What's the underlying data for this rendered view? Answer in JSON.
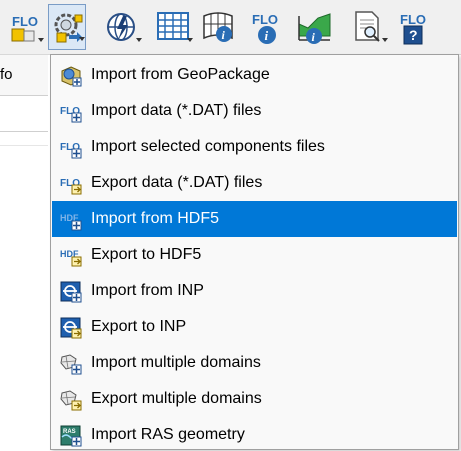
{
  "toolbar": {
    "buttons": [
      {
        "icon": "flo2d-yellow-icon",
        "dropdown": true,
        "active": false
      },
      {
        "icon": "import-export-gear-icon",
        "dropdown": true,
        "active": true
      },
      {
        "icon": "globe-lightning-icon",
        "dropdown": true,
        "active": false
      },
      {
        "icon": "grid-table-icon",
        "dropdown": true,
        "active": false
      },
      {
        "icon": "grid-info-icon",
        "dropdown": false,
        "active": false
      },
      {
        "icon": "flo2d-info-icon",
        "dropdown": false,
        "active": false
      },
      {
        "icon": "profile-info-icon",
        "dropdown": false,
        "active": false
      },
      {
        "icon": "document-search-icon",
        "dropdown": true,
        "active": false
      },
      {
        "icon": "flo2d-help-icon",
        "dropdown": false,
        "active": false
      }
    ]
  },
  "left_panel": {
    "tab_text": "fo"
  },
  "menu": {
    "items": [
      {
        "label": "Import from GeoPackage",
        "icon": "geopackage-import-icon",
        "highlighted": false
      },
      {
        "label": "Import data (*.DAT) files",
        "icon": "flo2d-import-dat-icon",
        "highlighted": false
      },
      {
        "label": "Import selected components files",
        "icon": "flo2d-import-selected-icon",
        "highlighted": false
      },
      {
        "label": "Export data (*.DAT) files",
        "icon": "flo2d-export-dat-icon",
        "highlighted": false
      },
      {
        "label": "Import from HDF5",
        "icon": "hdf5-import-icon",
        "highlighted": true
      },
      {
        "label": "Export to HDF5",
        "icon": "hdf5-export-icon",
        "highlighted": false
      },
      {
        "label": "Import from INP",
        "icon": "inp-import-icon",
        "highlighted": false
      },
      {
        "label": "Export to INP",
        "icon": "inp-export-icon",
        "highlighted": false
      },
      {
        "label": "Import multiple domains",
        "icon": "multiple-domains-import-icon",
        "highlighted": false
      },
      {
        "label": "Export multiple domains",
        "icon": "multiple-domains-export-icon",
        "highlighted": false
      },
      {
        "label": "Import RAS geometry",
        "icon": "ras-geometry-import-icon",
        "highlighted": false
      }
    ]
  },
  "colors": {
    "highlight": "#0078d7",
    "menu_background": "#f9f9f9",
    "toolbar_background": "#f0f0f0",
    "flo_blue": "#2a6db5",
    "accent_yellow": "#f2c200"
  }
}
